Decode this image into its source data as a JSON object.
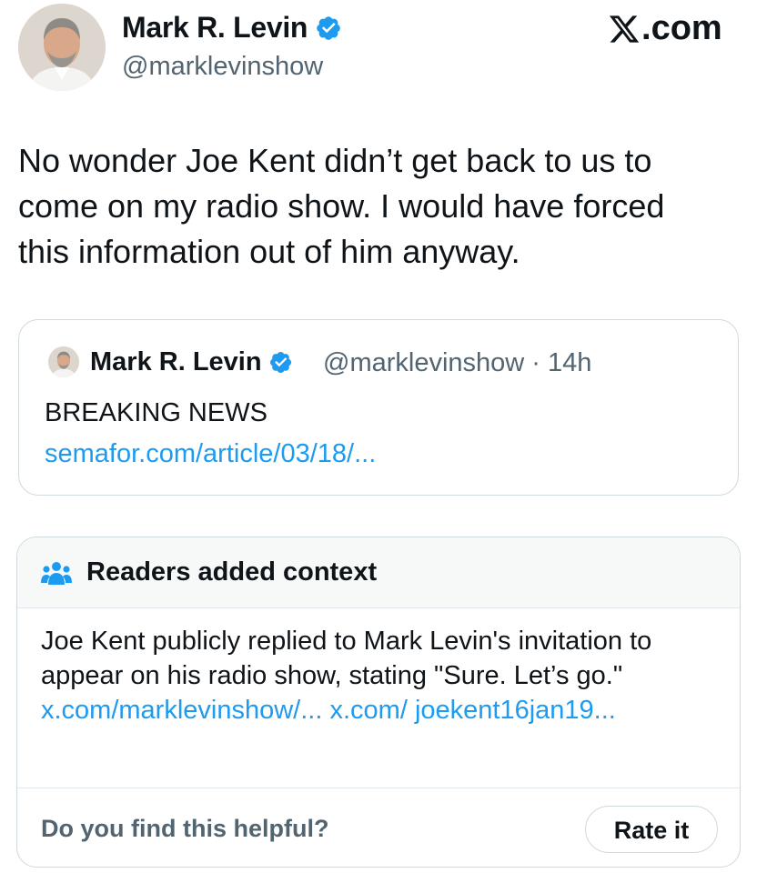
{
  "post": {
    "author_name": "Mark R. Levin",
    "handle": "@marklevinshow",
    "platform_badge": "com",
    "text_lines": [
      "No wonder Joe Kent didn’t get back to us to",
      "come on my radio show.  I would have forced",
      "this information out of him anyway."
    ]
  },
  "quote": {
    "author_name": "Mark R. Levin",
    "handle_time": "@marklevinshow · 14h",
    "text": "BREAKING NEWS",
    "link": "semafor.com/article/03/18/..."
  },
  "community_note": {
    "title": "Readers added context",
    "body_text": "Joe Kent publicly replied to Mark Levin's invitation to appear on his radio show, stating \"Sure. Let’s go.\" ",
    "link_1": "x.com/marklevinshow/...",
    "link_2": "x.com/ joekent16jan19...",
    "footer_question": "Do you find this helpful?",
    "rate_button": "Rate it"
  },
  "icons": {
    "verified": "verified-badge-icon",
    "x_logo": "x-logo-icon",
    "people": "people-icon"
  },
  "colors": {
    "verified_blue": "#1d9bf0",
    "link_blue": "#1d9bf0",
    "secondary_text": "#536471",
    "border": "#cfd9de",
    "note_header_bg": "#f7f9f9"
  }
}
